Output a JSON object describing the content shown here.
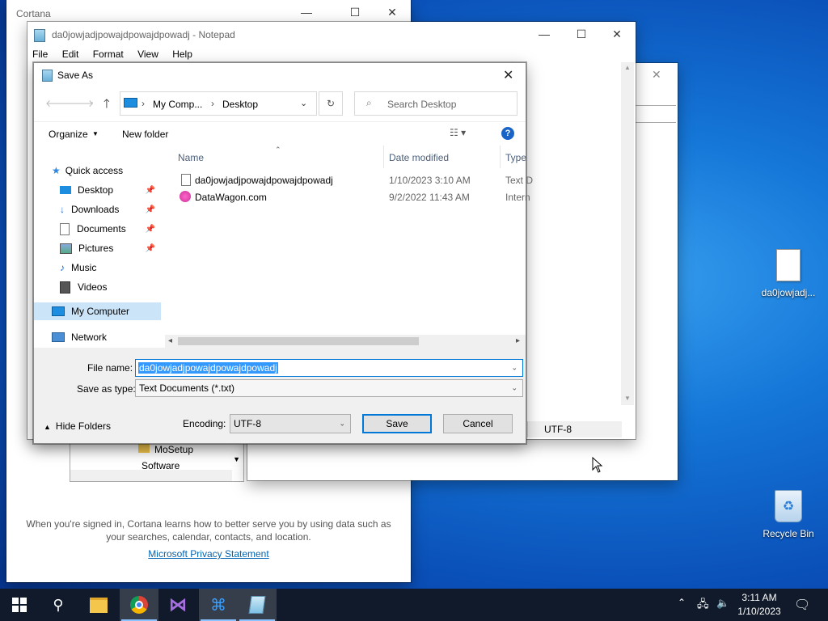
{
  "cortana": {
    "title": "Cortana",
    "text": "When you're signed in, Cortana learns how to better serve you by using data such as your searches, calendar, contacts, and location.",
    "link": "Microsoft Privacy Statement",
    "tree_items": [
      "MoSetup",
      "Software"
    ]
  },
  "notepad": {
    "title": "da0jowjadjpowajdpowajdpowadj - Notepad",
    "menu": [
      "File",
      "Edit",
      "Format",
      "View",
      "Help"
    ],
    "encoding_status": "UTF-8"
  },
  "saveas": {
    "title": "Save As",
    "breadcrumb": [
      "My Comp...",
      "Desktop"
    ],
    "search_placeholder": "Search Desktop",
    "organize": "Organize",
    "new_folder": "New folder",
    "nav": {
      "quick_access": "Quick access",
      "items": [
        "Desktop",
        "Downloads",
        "Documents",
        "Pictures",
        "Music",
        "Videos"
      ],
      "my_computer": "My Computer",
      "network": "Network"
    },
    "columns": [
      "Name",
      "Date modified",
      "Type"
    ],
    "files": [
      {
        "name": "da0jowjadjpowajdpowajdpowadj",
        "date": "1/10/2023 3:10 AM",
        "type": "Text D"
      },
      {
        "name": "DataWagon.com",
        "date": "9/2/2022 11:43 AM",
        "type": "Intern"
      }
    ],
    "file_name_label": "File name:",
    "file_name_value": "da0jowjadjpowajdpowajdpowadj",
    "save_type_label": "Save as type:",
    "save_type_value": "Text Documents (*.txt)",
    "hide_folders": "Hide Folders",
    "encoding_label": "Encoding:",
    "encoding_value": "UTF-8",
    "save_button": "Save",
    "cancel_button": "Cancel"
  },
  "desktop": {
    "file_icon_label": "da0jowjadj...",
    "recycle_bin_label": "Recycle Bin"
  },
  "taskbar": {
    "time": "3:11 AM",
    "date": "1/10/2023"
  },
  "colors": {
    "accent": "#0078d7",
    "selection": "#3399ff",
    "taskbar": "#101a2a"
  }
}
